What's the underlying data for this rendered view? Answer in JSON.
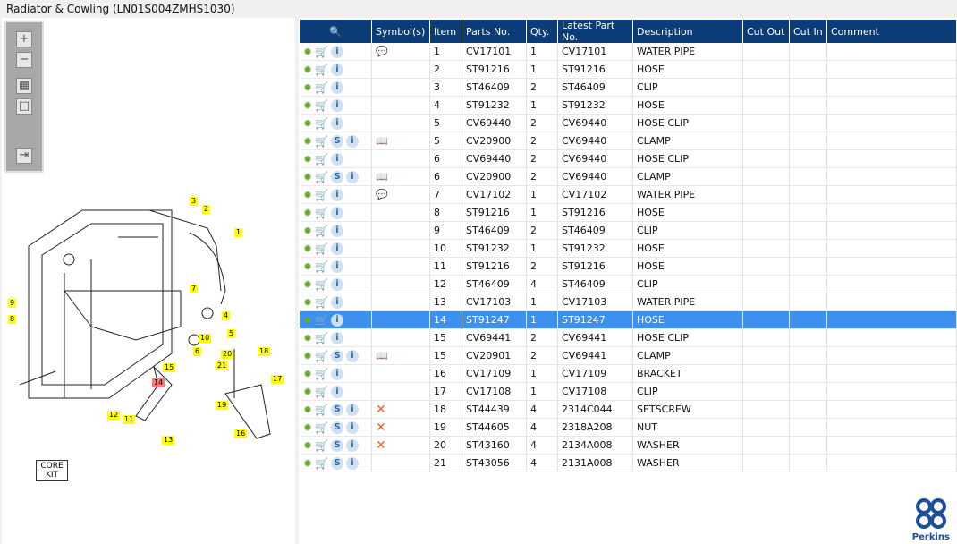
{
  "title": "Radiator & Cowling (LN01S004ZMHS1030)",
  "toolbar": {
    "zoom_in": "+",
    "zoom_out": "−",
    "fit": "▦",
    "actual": "□",
    "export": "⇥"
  },
  "diagram": {
    "callouts": [
      "1",
      "2",
      "3",
      "4",
      "5",
      "6",
      "7",
      "8",
      "9",
      "10",
      "11",
      "12",
      "13",
      "14",
      "15",
      "16",
      "17",
      "18",
      "19",
      "20",
      "21"
    ],
    "highlighted": "14",
    "core_kit": "CORE KIT"
  },
  "columns": [
    "",
    "Symbol(s)",
    "Item",
    "Parts No.",
    "Qty.",
    "Latest Part No.",
    "Description",
    "Cut Out",
    "Cut In",
    "Comment"
  ],
  "rows": [
    {
      "s": false,
      "sym": "note",
      "item": "1",
      "part": "CV17101",
      "qty": "1",
      "latest": "CV17101",
      "desc": "WATER PIPE"
    },
    {
      "s": false,
      "sym": "",
      "item": "2",
      "part": "ST91216",
      "qty": "1",
      "latest": "ST91216",
      "desc": "HOSE"
    },
    {
      "s": false,
      "sym": "",
      "item": "3",
      "part": "ST46409",
      "qty": "2",
      "latest": "ST46409",
      "desc": "CLIP"
    },
    {
      "s": false,
      "sym": "",
      "item": "4",
      "part": "ST91232",
      "qty": "1",
      "latest": "ST91232",
      "desc": "HOSE"
    },
    {
      "s": false,
      "sym": "",
      "item": "5",
      "part": "CV69440",
      "qty": "2",
      "latest": "CV69440",
      "desc": "HOSE CLIP"
    },
    {
      "s": true,
      "sym": "book",
      "item": "5",
      "part": "CV20900",
      "qty": "2",
      "latest": "CV69440",
      "desc": "CLAMP"
    },
    {
      "s": false,
      "sym": "",
      "item": "6",
      "part": "CV69440",
      "qty": "2",
      "latest": "CV69440",
      "desc": "HOSE CLIP"
    },
    {
      "s": true,
      "sym": "book",
      "item": "6",
      "part": "CV20900",
      "qty": "2",
      "latest": "CV69440",
      "desc": "CLAMP"
    },
    {
      "s": false,
      "sym": "note",
      "item": "7",
      "part": "CV17102",
      "qty": "1",
      "latest": "CV17102",
      "desc": "WATER PIPE"
    },
    {
      "s": false,
      "sym": "",
      "item": "8",
      "part": "ST91216",
      "qty": "1",
      "latest": "ST91216",
      "desc": "HOSE"
    },
    {
      "s": false,
      "sym": "",
      "item": "9",
      "part": "ST46409",
      "qty": "2",
      "latest": "ST46409",
      "desc": "CLIP"
    },
    {
      "s": false,
      "sym": "",
      "item": "10",
      "part": "ST91232",
      "qty": "1",
      "latest": "ST91232",
      "desc": "HOSE"
    },
    {
      "s": false,
      "sym": "",
      "item": "11",
      "part": "ST91216",
      "qty": "2",
      "latest": "ST91216",
      "desc": "HOSE"
    },
    {
      "s": false,
      "sym": "",
      "item": "12",
      "part": "ST46409",
      "qty": "4",
      "latest": "ST46409",
      "desc": "CLIP"
    },
    {
      "s": false,
      "sym": "",
      "item": "13",
      "part": "CV17103",
      "qty": "1",
      "latest": "CV17103",
      "desc": "WATER PIPE"
    },
    {
      "s": false,
      "sym": "",
      "item": "14",
      "part": "ST91247",
      "qty": "1",
      "latest": "ST91247",
      "desc": "HOSE",
      "selected": true
    },
    {
      "s": false,
      "sym": "",
      "item": "15",
      "part": "CV69441",
      "qty": "2",
      "latest": "CV69441",
      "desc": "HOSE CLIP"
    },
    {
      "s": true,
      "sym": "book",
      "item": "15",
      "part": "CV20901",
      "qty": "2",
      "latest": "CV69441",
      "desc": "CLAMP"
    },
    {
      "s": false,
      "sym": "",
      "item": "16",
      "part": "CV17109",
      "qty": "1",
      "latest": "CV17109",
      "desc": "BRACKET"
    },
    {
      "s": false,
      "sym": "",
      "item": "17",
      "part": "CV17108",
      "qty": "1",
      "latest": "CV17108",
      "desc": "CLIP"
    },
    {
      "s": true,
      "sym": "x",
      "item": "18",
      "part": "ST44439",
      "qty": "4",
      "latest": "2314C044",
      "desc": "SETSCREW"
    },
    {
      "s": true,
      "sym": "x",
      "item": "19",
      "part": "ST44605",
      "qty": "4",
      "latest": "2318A208",
      "desc": "NUT"
    },
    {
      "s": true,
      "sym": "x",
      "item": "20",
      "part": "ST43160",
      "qty": "4",
      "latest": "2134A008",
      "desc": "WASHER"
    },
    {
      "s": true,
      "sym": "",
      "item": "21",
      "part": "ST43056",
      "qty": "4",
      "latest": "2131A008",
      "desc": "WASHER"
    }
  ],
  "logo": {
    "text": "Perkins",
    "color": "#1d4e99"
  },
  "colors": {
    "header": "#0b3c78",
    "selected": "#3d8ff0",
    "callout": "#ffff00",
    "callout_highlight": "#ff7777"
  }
}
